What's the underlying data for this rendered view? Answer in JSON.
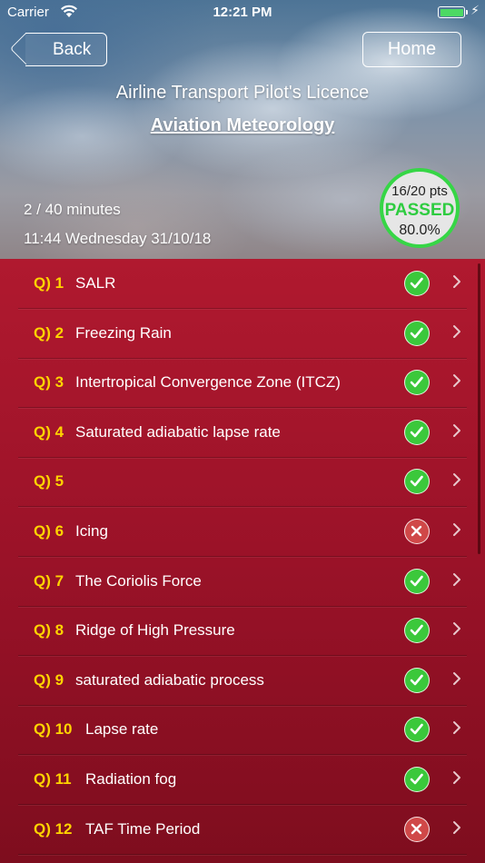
{
  "status_bar": {
    "carrier": "Carrier",
    "time": "12:21 PM"
  },
  "nav": {
    "back_label": "Back",
    "home_label": "Home"
  },
  "header": {
    "licence": "Airline Transport Pilot's Licence",
    "subject": "Aviation Meteorology",
    "minutes": "2 / 40 minutes",
    "datetime": "11:44 Wednesday 31/10/18"
  },
  "score": {
    "points": "16/20 pts",
    "status": "PASSED",
    "percent": "80.0%"
  },
  "colors": {
    "question_number": "#ffd400",
    "correct": "#3bc83b",
    "incorrect": "#d04848",
    "badge_border": "#36d646"
  },
  "questions": [
    {
      "num": "Q) 1",
      "text": "SALR",
      "result": "correct"
    },
    {
      "num": "Q) 2",
      "text": "Freezing Rain",
      "result": "correct"
    },
    {
      "num": "Q) 3",
      "text": "Intertropical Convergence Zone (ITCZ)",
      "result": "correct"
    },
    {
      "num": "Q) 4",
      "text": "Saturated adiabatic lapse rate",
      "result": "correct"
    },
    {
      "num": "Q) 5",
      "text": "",
      "result": "correct"
    },
    {
      "num": "Q) 6",
      "text": "Icing",
      "result": "incorrect"
    },
    {
      "num": "Q) 7",
      "text": "The Coriolis Force",
      "result": "correct"
    },
    {
      "num": "Q) 8",
      "text": "Ridge of High Pressure",
      "result": "correct"
    },
    {
      "num": "Q) 9",
      "text": "saturated adiabatic process",
      "result": "correct"
    },
    {
      "num": "Q) 10",
      "text": "Lapse rate",
      "result": "correct"
    },
    {
      "num": "Q) 11",
      "text": "Radiation fog",
      "result": "correct"
    },
    {
      "num": "Q) 12",
      "text": "TAF Time Period",
      "result": "incorrect"
    }
  ]
}
